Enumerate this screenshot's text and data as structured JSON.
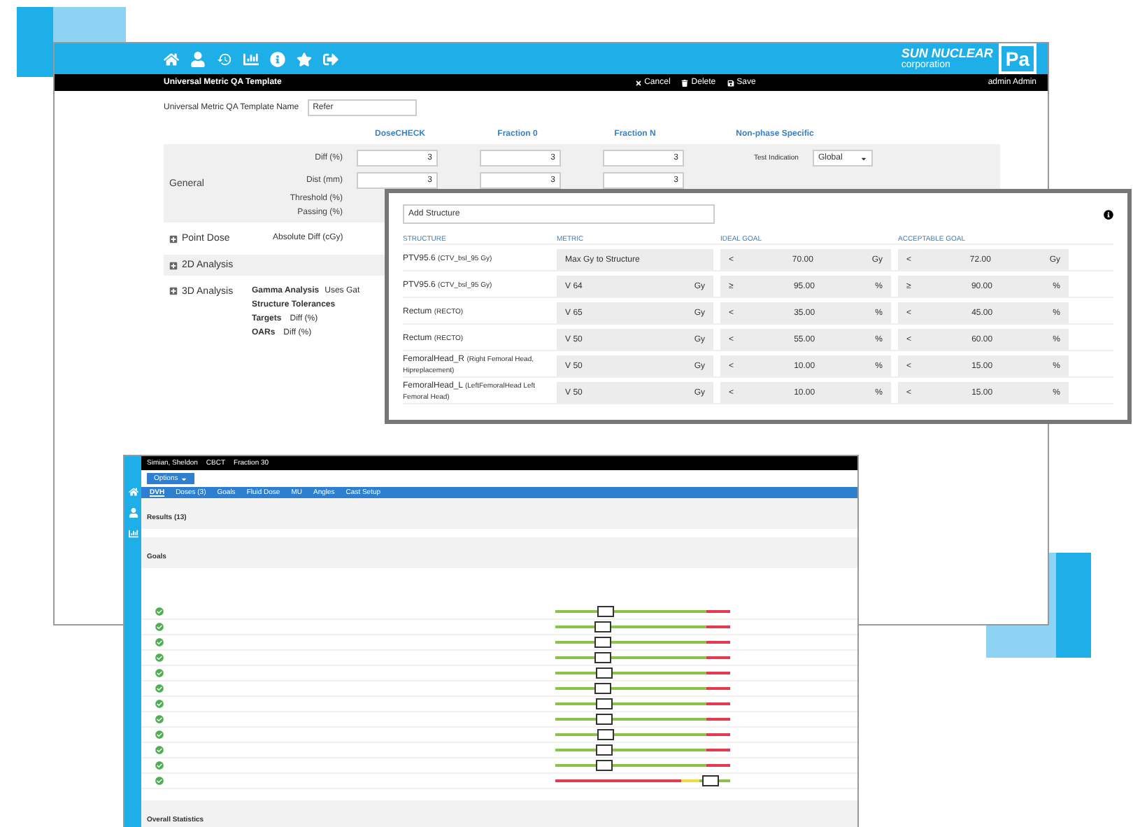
{
  "back_window": {
    "logo": {
      "name": "SUN NUCLEAR",
      "sub": "corporation",
      "badge": "Pa"
    },
    "title": "Universal Metric QA Template",
    "actions": [
      "Cancel",
      "Delete",
      "Save"
    ],
    "user": "admin Admin",
    "name_field": {
      "label": "Universal Metric QA Template Name",
      "value": "Refer"
    },
    "columns": [
      "DoseCHECK",
      "Fraction 0",
      "Fraction N",
      "Non-phase Specific"
    ],
    "general": {
      "label": "General",
      "rows": [
        {
          "label": "Diff (%)",
          "values": [
            "3",
            "3",
            "3"
          ]
        },
        {
          "label": "Dist (mm)",
          "values": [
            "3",
            "3",
            "3"
          ]
        },
        {
          "label": "Threshold (%)",
          "values": []
        },
        {
          "label": "Passing (%)",
          "values": []
        }
      ],
      "test_label": "Test Indication",
      "test_value": "Global"
    },
    "point_dose": {
      "label": "Point Dose",
      "field": "Absolute Diff (cGy)"
    },
    "analysis_2d": {
      "label": "2D Analysis"
    },
    "analysis_3d": {
      "label": "3D Analysis",
      "gamma": "Gamma Analysis",
      "uses": "Uses Gat",
      "tolerances": "Structure Tolerances",
      "rows": [
        {
          "label": "Targets",
          "field": "Diff (%)"
        },
        {
          "label": "OARs",
          "field": "Diff (%)"
        }
      ]
    }
  },
  "popup": {
    "add": "Add Structure",
    "headers": [
      "STRUCTURE",
      "METRIC",
      "IDEAL GOAL",
      "ACCEPTABLE GOAL"
    ],
    "rows": [
      {
        "name": "PTV95.6",
        "detail": "(CTV_bsl_95 Gy)",
        "kind": "text",
        "metric": "Max Gy to Structure",
        "ideal": [
          "<",
          "70.00",
          "Gy"
        ],
        "accept": [
          "<",
          "72.00",
          "Gy"
        ]
      },
      {
        "name": "PTV95.6",
        "detail": "(CTV_bsl_95 Gy)",
        "kind": "volume",
        "prefix": "V",
        "metric": "64",
        "unit": "Gy",
        "ideal": [
          "≥",
          "95.00",
          "%"
        ],
        "accept": [
          "≥",
          "90.00",
          "%"
        ]
      },
      {
        "name": "Rectum",
        "detail": "(RECTO)",
        "kind": "volume",
        "prefix": "V",
        "metric": "65",
        "unit": "Gy",
        "ideal": [
          "<",
          "35.00",
          "%"
        ],
        "accept": [
          "<",
          "45.00",
          "%"
        ]
      },
      {
        "name": "Rectum",
        "detail": "(RECTO)",
        "kind": "volume",
        "prefix": "V",
        "metric": "50",
        "unit": "Gy",
        "ideal": [
          "<",
          "55.00",
          "%"
        ],
        "accept": [
          "<",
          "60.00",
          "%"
        ]
      },
      {
        "name": "FemoralHead_R",
        "detail": "(Right Femoral Head, Hipreplacement)",
        "kind": "volume",
        "prefix": "V",
        "metric": "50",
        "unit": "Gy",
        "ideal": [
          "<",
          "10.00",
          "%"
        ],
        "accept": [
          "<",
          "15.00",
          "%"
        ]
      },
      {
        "name": "FemoralHead_L",
        "detail": "(LeftFemoralHead Left Femoral Head)",
        "kind": "volume",
        "prefix": "V",
        "metric": "50",
        "unit": "Gy",
        "ideal": [
          "<",
          "10.00",
          "%"
        ],
        "accept": [
          "<",
          "15.00",
          "%"
        ]
      }
    ]
  },
  "front_window": {
    "patient": "Simian, Sheldon",
    "plan": "CBCT",
    "fraction": "Fraction 30",
    "options": "Options",
    "tabs": [
      {
        "label": "DVH",
        "selected": true
      },
      {
        "label": "Doses (3)",
        "selected": false
      },
      {
        "label": "Goals",
        "selected": false
      },
      {
        "label": "Fluid Dose",
        "selected": false
      },
      {
        "label": "MU",
        "selected": false
      },
      {
        "label": "Angles",
        "selected": false
      },
      {
        "label": "Cast Setup",
        "selected": false
      }
    ],
    "results": "Results (13)",
    "goals": "Goals",
    "goal_rows": [
      {
        "kind": "upper",
        "level": 0.28
      },
      {
        "kind": "upper",
        "level": 0.26
      },
      {
        "kind": "upper",
        "level": 0.26
      },
      {
        "kind": "upper",
        "level": 0.26
      },
      {
        "kind": "upper",
        "level": 0.27
      },
      {
        "kind": "upper",
        "level": 0.26
      },
      {
        "kind": "upper",
        "level": 0.27
      },
      {
        "kind": "upper",
        "level": 0.27
      },
      {
        "kind": "upper",
        "level": 0.28
      },
      {
        "kind": "upper",
        "level": 0.27
      },
      {
        "kind": "upper",
        "level": 0.27
      },
      {
        "kind": "lower",
        "level": 0.88
      }
    ],
    "overall": "Overall Statistics"
  }
}
